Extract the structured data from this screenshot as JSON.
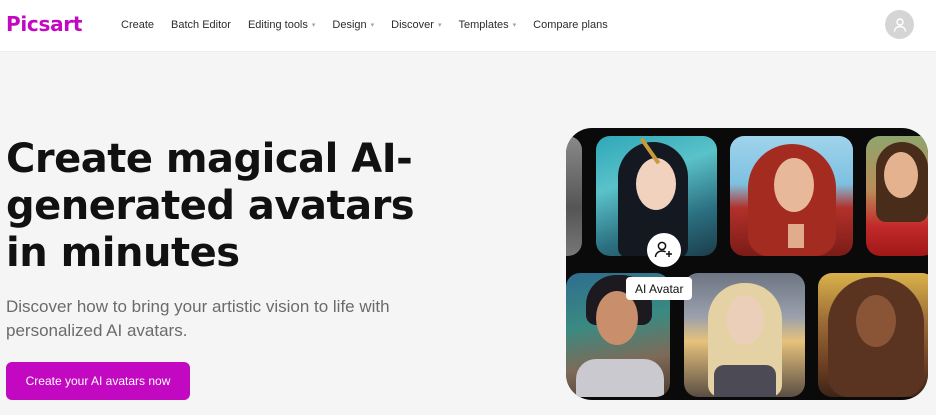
{
  "brand": {
    "logo_text": "Picsart",
    "accent": "#c209c1"
  },
  "nav": {
    "items": [
      {
        "label": "Create",
        "dropdown": false
      },
      {
        "label": "Batch Editor",
        "dropdown": false
      },
      {
        "label": "Editing tools",
        "dropdown": true
      },
      {
        "label": "Design",
        "dropdown": true
      },
      {
        "label": "Discover",
        "dropdown": true
      },
      {
        "label": "Templates",
        "dropdown": true
      },
      {
        "label": "Compare plans",
        "dropdown": false
      }
    ],
    "caret_glyph": "▾"
  },
  "hero": {
    "title": "Create magical AI-generated avatars in minutes",
    "subtitle": "Discover how to bring your artistic vision to life with personalized AI avatars.",
    "cta_label": "Create your AI avatars now"
  },
  "collage": {
    "badge_label": "AI Avatar",
    "badge_icon": "add-user-icon"
  },
  "user": {
    "avatar_icon": "user-icon"
  }
}
